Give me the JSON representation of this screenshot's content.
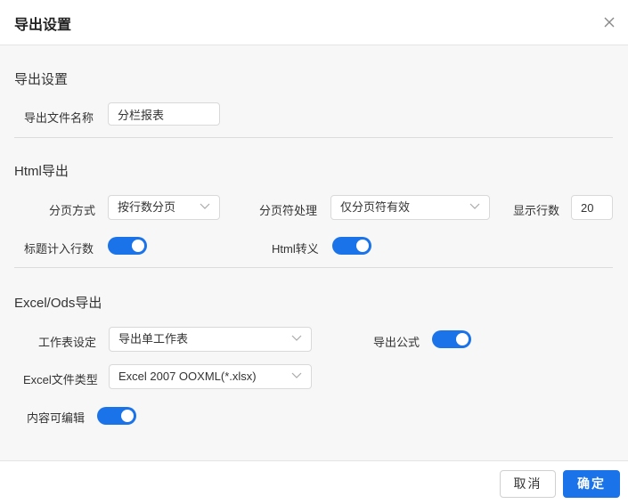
{
  "dialog": {
    "title": "导出设置",
    "close_icon": "close-icon"
  },
  "export_settings": {
    "section_title": "导出设置",
    "file_name_label": "导出文件名称",
    "file_name_value": "分栏报表"
  },
  "html_export": {
    "section_title": "Html导出",
    "paging_mode_label": "分页方式",
    "paging_mode_value": "按行数分页",
    "page_break_label": "分页符处理",
    "page_break_value": "仅分页符有效",
    "rows_label": "显示行数",
    "rows_value": "20",
    "title_rows_label": "标题计入行数",
    "title_rows_on": true,
    "html_escape_label": "Html转义",
    "html_escape_on": true
  },
  "excel_export": {
    "section_title": "Excel/Ods导出",
    "sheet_label": "工作表设定",
    "sheet_value": "导出单工作表",
    "formula_label": "导出公式",
    "formula_on": true,
    "file_type_label": "Excel文件类型",
    "file_type_value": "Excel 2007 OOXML(*.xlsx)",
    "editable_label": "内容可编辑",
    "editable_on": true
  },
  "footer": {
    "cancel_label": "取消",
    "ok_label": "确定"
  },
  "colors": {
    "accent": "#1a73e8",
    "body_bg": "#f7f7f7"
  }
}
